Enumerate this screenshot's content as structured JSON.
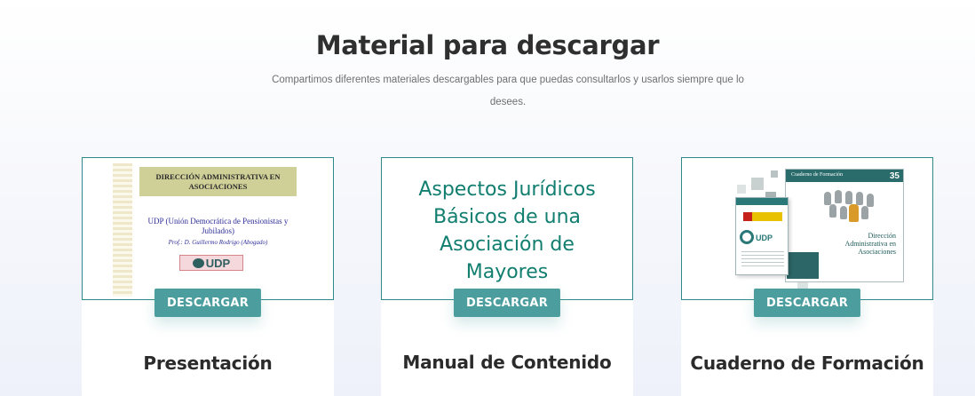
{
  "section": {
    "title": "Material para descargar",
    "subtitle": "Compartimos diferentes materiales descargables para que puedas consultarlos y usarlos siempre que lo desees."
  },
  "cards": [
    {
      "title": "Presentación",
      "button": "DESCARGAR",
      "thumb": {
        "header": "DIRECCIÓN ADMINISTRATIVA EN ASOCIACIONES",
        "org": "UDP (Unión Democrática de Pensionistas y Jubilados)",
        "prof": "Prof.: D. Guillermo Rodrigo (Abogado)",
        "logo": "UDP"
      }
    },
    {
      "title": "Manual de Contenido",
      "button": "DESCARGAR",
      "thumb": {
        "text": "Aspectos Jurídicos Básicos de una Asociación de Mayores"
      }
    },
    {
      "title": "Cuaderno de Formación",
      "button": "DESCARGAR",
      "thumb": {
        "cover_label": "Cuaderno de Formación",
        "cover_num": "35",
        "cover_title": "Dirección Administrativa en Asociaciones",
        "doc_logo": "UDP"
      }
    }
  ],
  "colors": {
    "accent": "#4c9e9e",
    "thumb_border": "#2e8a8a",
    "heading": "#2f2f2f",
    "body_text": "#6f6f6f",
    "thumb2_text": "#117e70"
  }
}
